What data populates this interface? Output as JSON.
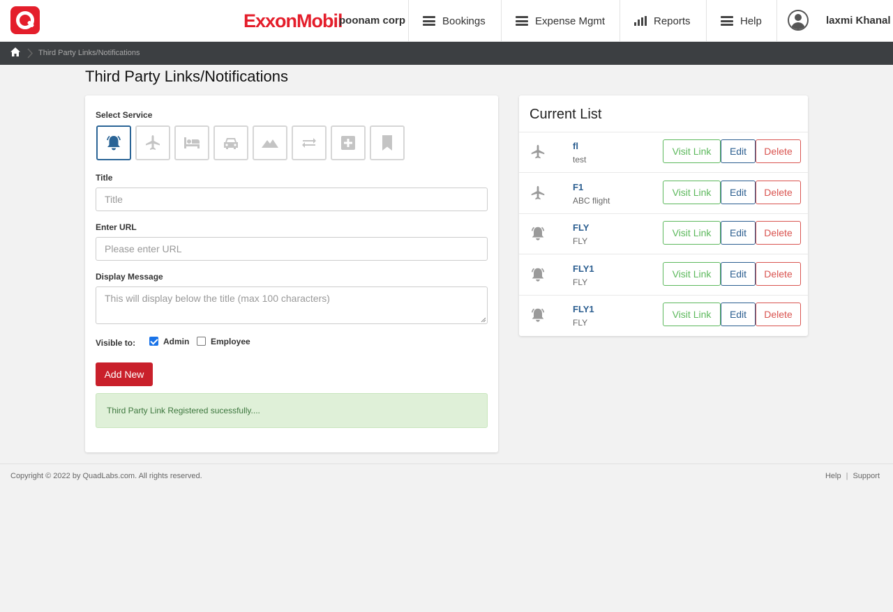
{
  "header": {
    "brand": "ExxonMobil",
    "corp": "poonam corp",
    "nav": [
      {
        "label": "Bookings"
      },
      {
        "label": "Expense Mgmt"
      },
      {
        "label": "Reports"
      },
      {
        "label": "Help"
      }
    ],
    "user": "laxmi Khanal"
  },
  "breadcrumb": {
    "current": "Third Party Links/Notifications"
  },
  "page": {
    "title": "Third Party Links/Notifications"
  },
  "form": {
    "select_service_label": "Select Service",
    "services": [
      "bell-icon",
      "plane-icon",
      "bed-icon",
      "car-icon",
      "mountain-icon",
      "transfer-icon",
      "plus-square-icon",
      "bookmark-icon"
    ],
    "active_service": "bell-icon",
    "title_label": "Title",
    "title_placeholder": "Title",
    "url_label": "Enter URL",
    "url_placeholder": "Please enter URL",
    "message_label": "Display Message",
    "message_placeholder": "This will display below the title (max 100 characters)",
    "visible_label": "Visible to:",
    "admin_label": "Admin",
    "admin_checked": true,
    "employee_label": "Employee",
    "employee_checked": false,
    "add_button": "Add New",
    "alert": "Third Party Link Registered sucessfully...."
  },
  "list": {
    "title": "Current List",
    "visit_label": "Visit Link",
    "edit_label": "Edit",
    "delete_label": "Delete",
    "items": [
      {
        "icon": "plane-icon",
        "title": "fl",
        "subtitle": "test"
      },
      {
        "icon": "plane-icon",
        "title": "F1",
        "subtitle": "ABC flight"
      },
      {
        "icon": "bell-icon",
        "title": "FLY",
        "subtitle": "FLY"
      },
      {
        "icon": "bell-icon",
        "title": "FLY1",
        "subtitle": "FLY"
      },
      {
        "icon": "bell-icon",
        "title": "FLY1",
        "subtitle": "FLY"
      }
    ]
  },
  "footer": {
    "copyright": "Copyright © 2022 by QuadLabs.com. All rights reserved.",
    "help": "Help",
    "separator": "|",
    "support": "Support"
  },
  "colors": {
    "brand_red": "#e41e2b",
    "active_blue": "#2a6496",
    "visit_green": "#5cb85c",
    "delete_red": "#d9534f",
    "add_button": "#c9202b"
  }
}
